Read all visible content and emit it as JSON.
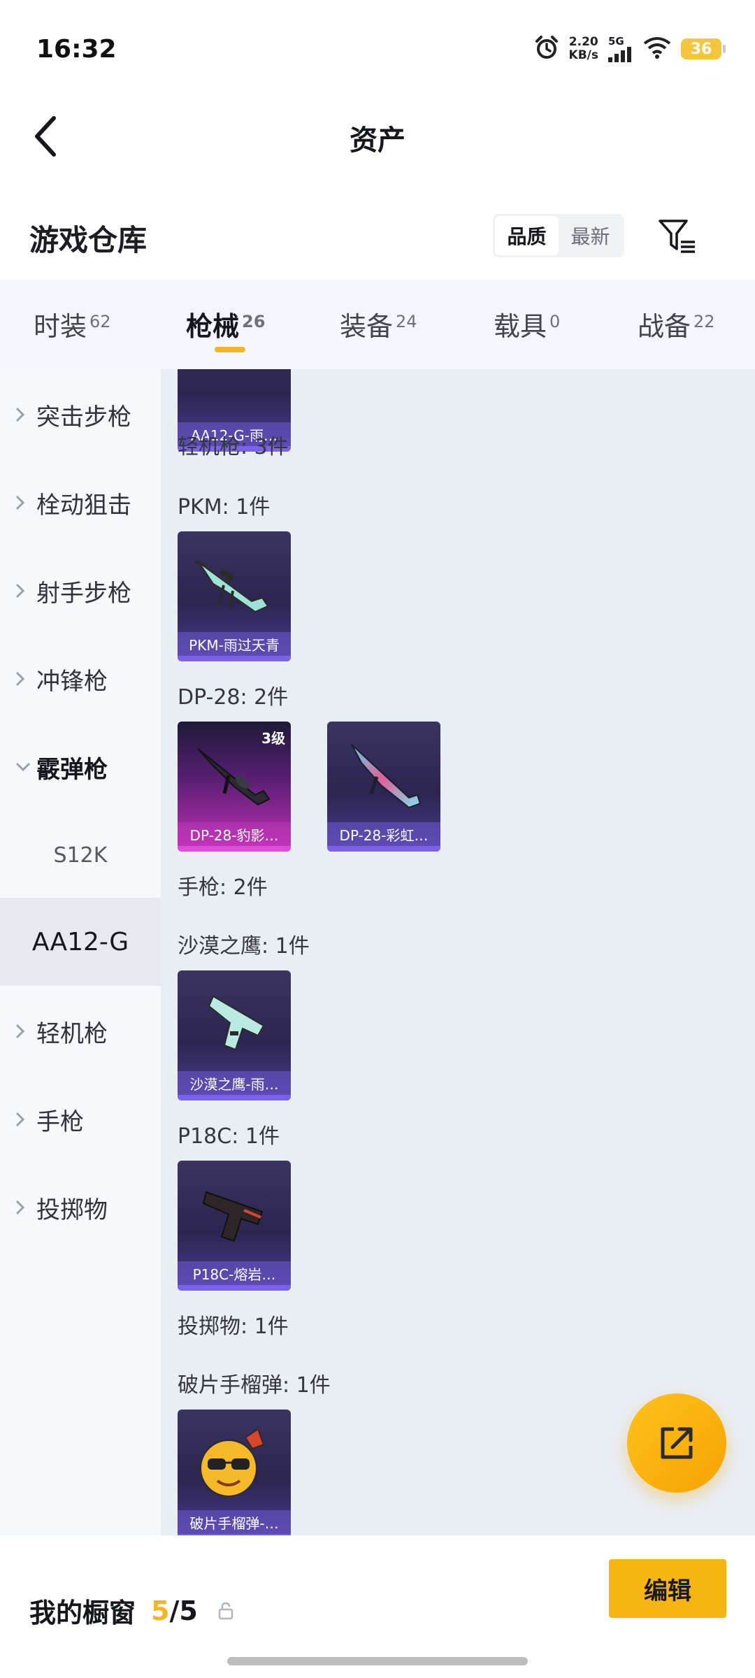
{
  "status_bar": {
    "time": "16:32",
    "net_speed_value": "2.20",
    "net_speed_unit": "KB/s",
    "network": "5G",
    "battery": "36",
    "icons": [
      "alarm-icon",
      "signal-icon",
      "wifi-icon",
      "battery-icon"
    ]
  },
  "header": {
    "title": "资产",
    "back_icon": "chevron-left-icon"
  },
  "warehouse": {
    "title": "游戏仓库",
    "sort_options": [
      "品质",
      "最新"
    ],
    "sort_selected": "品质",
    "filter_icon": "filter-icon"
  },
  "tabs": [
    {
      "label": "时装",
      "count": "62"
    },
    {
      "label": "枪械",
      "count": "26"
    },
    {
      "label": "装备",
      "count": "24"
    },
    {
      "label": "载具",
      "count": "0"
    },
    {
      "label": "战备",
      "count": "22"
    }
  ],
  "active_tab": "枪械",
  "sidebar": [
    {
      "label": "突击步枪",
      "type": "collapsed"
    },
    {
      "label": "栓动狙击",
      "type": "collapsed"
    },
    {
      "label": "射手步枪",
      "type": "collapsed"
    },
    {
      "label": "冲锋枪",
      "type": "collapsed"
    },
    {
      "label": "霰弹枪",
      "type": "expanded"
    },
    {
      "label": "S12K",
      "type": "sub"
    },
    {
      "label": "AA12-G",
      "type": "selected"
    },
    {
      "label": "轻机枪",
      "type": "collapsed"
    },
    {
      "label": "手枪",
      "type": "collapsed"
    },
    {
      "label": "投掷物",
      "type": "collapsed"
    }
  ],
  "content": {
    "groups": [
      {
        "label": "轻机枪: 3件"
      },
      {
        "label": "PKM: 1件"
      },
      {
        "label": "DP-28: 2件"
      },
      {
        "label": "手枪: 2件"
      },
      {
        "label": "沙漠之鹰: 1件"
      },
      {
        "label": "P18C: 1件"
      },
      {
        "label": "投掷物: 1件"
      },
      {
        "label": "破片手榴弹: 1件"
      }
    ],
    "items": [
      {
        "label": "AA12-G-雨…",
        "art": "shotgun-icon"
      },
      {
        "label": "PKM-雨过天青",
        "art": "machine-gun-icon"
      },
      {
        "label": "DP-28-豹影…",
        "art": "machine-gun-icon",
        "level": "3级"
      },
      {
        "label": "DP-28-彩虹…",
        "art": "rifle-icon"
      },
      {
        "label": "沙漠之鹰-雨…",
        "art": "pistol-icon"
      },
      {
        "label": "P18C-熔岩…",
        "art": "pistol-icon"
      },
      {
        "label": "破片手榴弹-…",
        "art": "grenade-icon"
      }
    ]
  },
  "fab": {
    "icon": "share-icon"
  },
  "bottom": {
    "showcase_label": "我的橱窗",
    "showcase_current": "5",
    "showcase_sep": "/",
    "showcase_total": "5",
    "lock_icon": "lock-icon",
    "edit_label": "编辑"
  },
  "colors": {
    "accent": "#f5b423",
    "sidebar_bg": "#f6f9fc",
    "content_bg": "#e9edf4",
    "card_purple": "#2c2550",
    "card_pink": "#c32fb9"
  }
}
